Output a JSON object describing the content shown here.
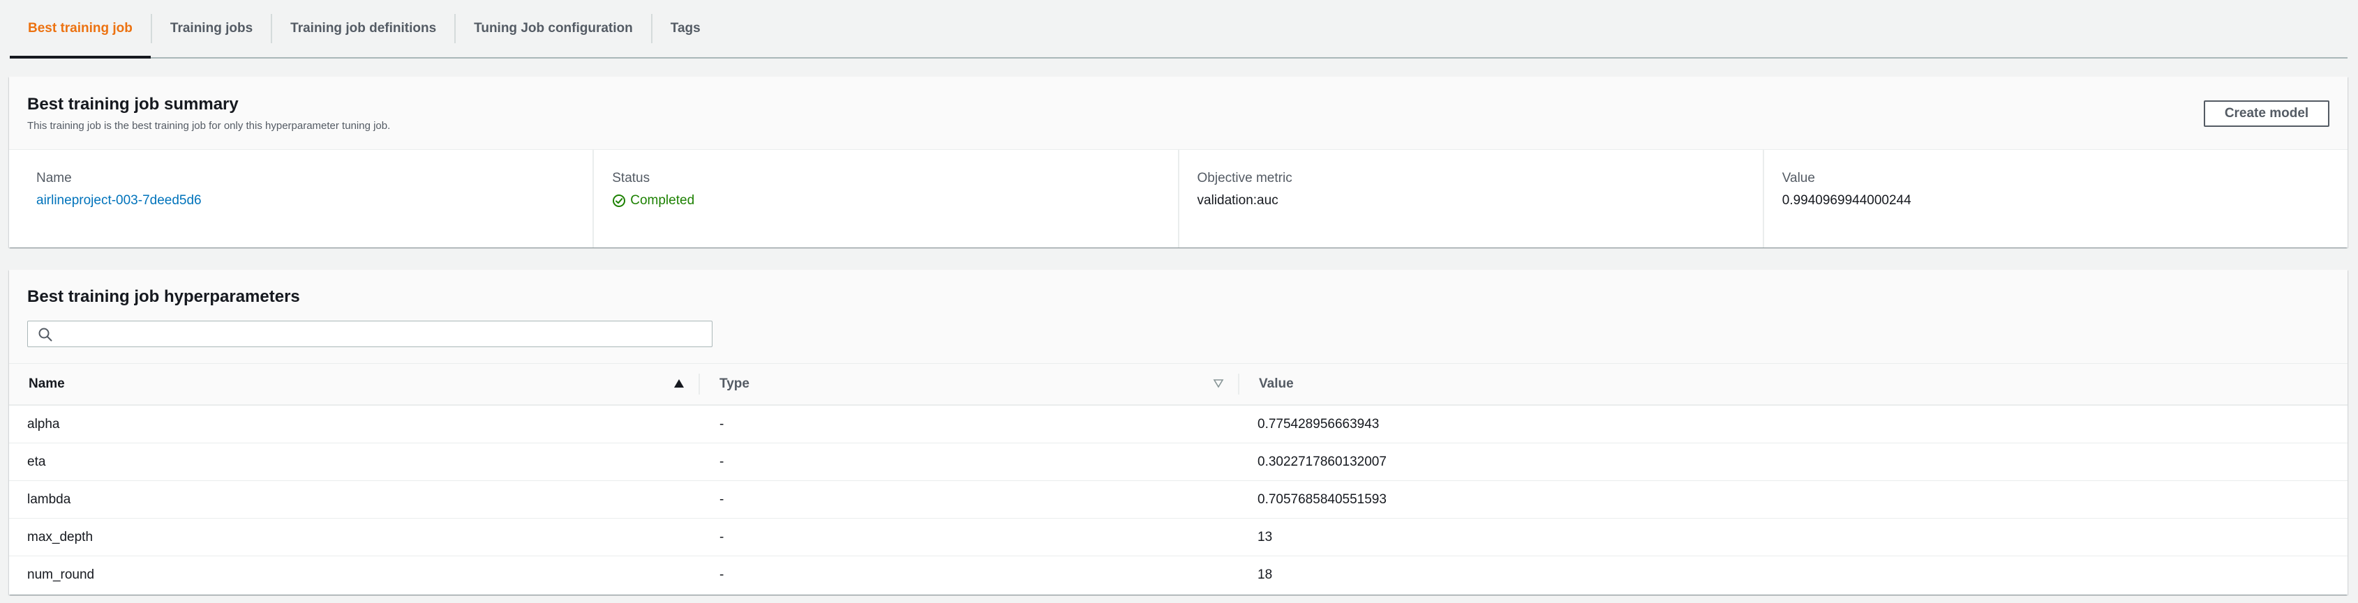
{
  "tabs": [
    {
      "label": "Best training job",
      "active": true
    },
    {
      "label": "Training jobs",
      "active": false
    },
    {
      "label": "Training job definitions",
      "active": false
    },
    {
      "label": "Tuning Job configuration",
      "active": false
    },
    {
      "label": "Tags",
      "active": false
    }
  ],
  "summary": {
    "title": "Best training job summary",
    "description": "This training job is the best training job for only this hyperparameter tuning job.",
    "create_model_label": "Create model",
    "fields": {
      "name": {
        "label": "Name",
        "value": "airlineproject-003-7deed5d6"
      },
      "status": {
        "label": "Status",
        "value": "Completed"
      },
      "objective_metric": {
        "label": "Objective metric",
        "value": "validation:auc"
      },
      "value": {
        "label": "Value",
        "value": "0.9940969944000244"
      }
    }
  },
  "hyperparameters": {
    "title": "Best training job hyperparameters",
    "search_placeholder": "",
    "columns": {
      "name": "Name",
      "type": "Type",
      "value": "Value"
    },
    "sort": {
      "column": "Name",
      "direction": "ascending"
    },
    "rows": [
      {
        "name": "alpha",
        "type": "-",
        "value": "0.775428956663943"
      },
      {
        "name": "eta",
        "type": "-",
        "value": "0.3022717860132007"
      },
      {
        "name": "lambda",
        "type": "-",
        "value": "0.7057685840551593"
      },
      {
        "name": "max_depth",
        "type": "-",
        "value": "13"
      },
      {
        "name": "num_round",
        "type": "-",
        "value": "18"
      }
    ]
  },
  "colors": {
    "accent_tab": "#ec7211",
    "link": "#0073bb",
    "success": "#1d8102"
  }
}
